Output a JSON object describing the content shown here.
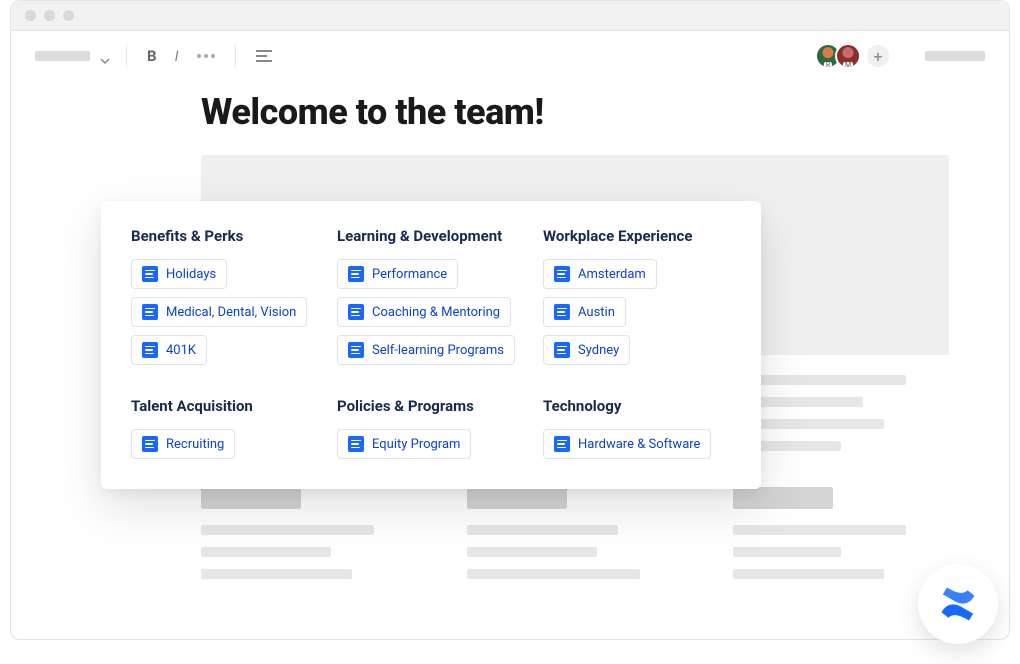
{
  "page": {
    "title": "Welcome to the team!"
  },
  "avatars": {
    "user1_initial": "R",
    "user2_initial": "M",
    "add_label": "+"
  },
  "card": {
    "sections": [
      {
        "title": "Benefits & Perks",
        "items": [
          "Holidays",
          "Medical, Dental, Vision",
          "401K"
        ]
      },
      {
        "title": "Learning & Development",
        "items": [
          "Performance",
          "Coaching & Mentoring",
          "Self-learning Programs"
        ]
      },
      {
        "title": "Workplace Experience",
        "items": [
          "Amsterdam",
          "Austin",
          "Sydney"
        ]
      },
      {
        "title": "Talent Acquisition",
        "items": [
          "Recruiting"
        ]
      },
      {
        "title": "Policies & Programs",
        "items": [
          "Equity Program"
        ]
      },
      {
        "title": "Technology",
        "items": [
          "Hardware & Software"
        ]
      }
    ]
  }
}
